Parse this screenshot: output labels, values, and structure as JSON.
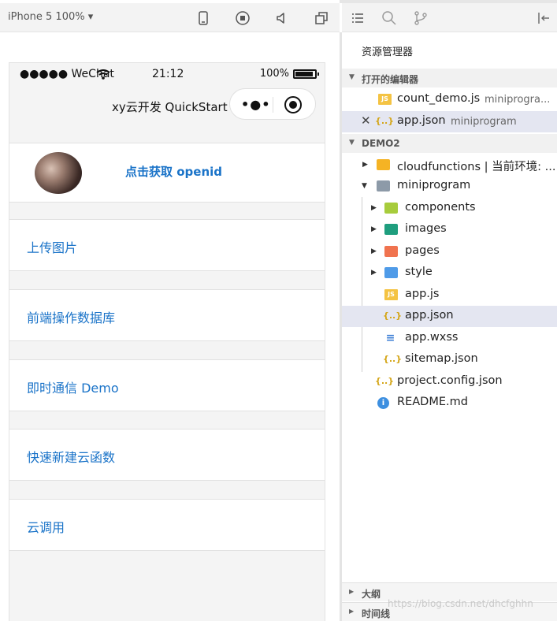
{
  "simulator": {
    "device_label": "iPhone 5 100% ▾",
    "toolbar_icons": [
      "phone-icon",
      "record-icon",
      "speaker-icon",
      "window-icon"
    ],
    "status": {
      "carrier": "●●●●● WeChat",
      "time": "21:12",
      "battery": "100%"
    },
    "nav_title": "xy云开发 QuickStart",
    "capsule_dots": "•●•",
    "openid_button": "点击获取 openid",
    "menu": [
      "上传图片",
      "前端操作数据库",
      "即时通信 Demo",
      "快速新建云函数",
      "云调用"
    ]
  },
  "explorer": {
    "toolbar_icons": [
      "list-icon",
      "search-icon",
      "branch-icon",
      "collapse-icon"
    ],
    "title": "资源管理器",
    "open_editors": {
      "header": "打开的编辑器",
      "items": [
        {
          "name": "count_demo.js",
          "hint": "miniprogra..."
        },
        {
          "name": "app.json",
          "hint": "miniprogram"
        }
      ]
    },
    "project": {
      "header": "DEMO2",
      "cloudfunctions": "cloudfunctions | 当前环境: ...",
      "miniprogram": "miniprogram",
      "children": [
        "components",
        "images",
        "pages",
        "style",
        "app.js",
        "app.json",
        "app.wxss",
        "sitemap.json"
      ],
      "root_files": [
        "project.config.json",
        "README.md"
      ]
    },
    "bottom_sections": [
      "大纲",
      "时间线"
    ],
    "watermark": "https://blog.csdn.net/dhcfghhn"
  },
  "colors": {
    "link_blue": "#1a73c8",
    "selected_row": "#e4e6f1",
    "folder_cloud": "#f5b324",
    "folder_components": "#a7cc3c",
    "folder_images": "#1f9e7e",
    "folder_pages": "#f0734f",
    "folder_style": "#4f9be8",
    "folder_mini": "#8d9aa8"
  }
}
